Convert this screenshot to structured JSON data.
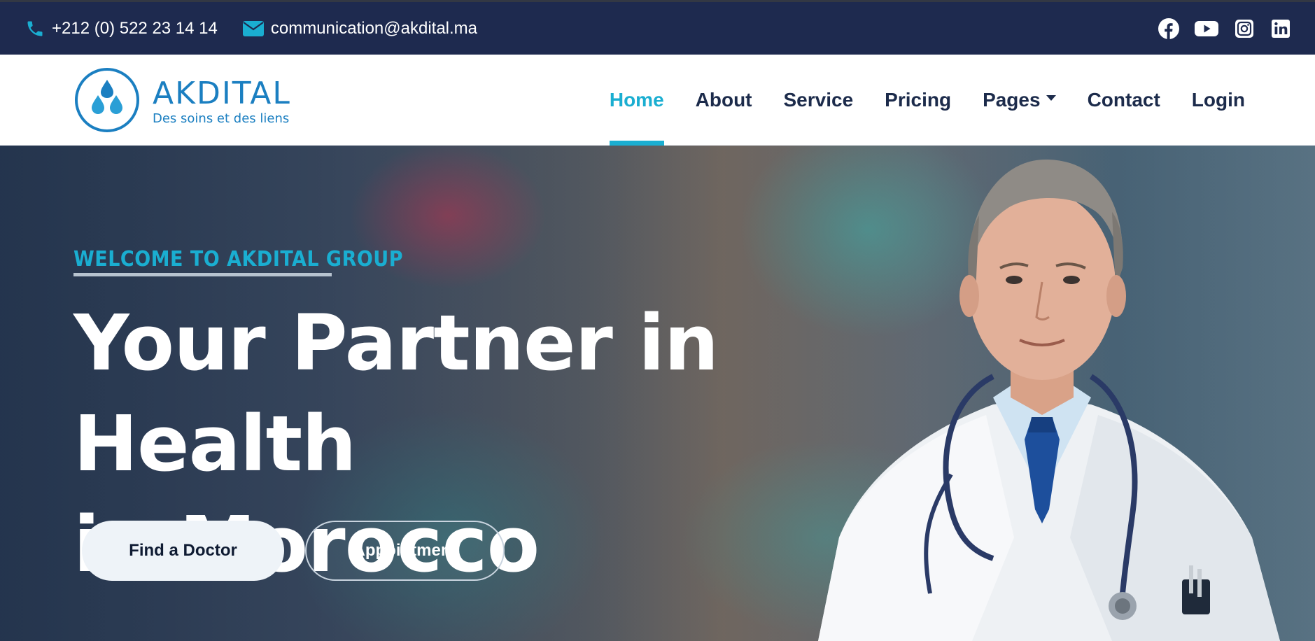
{
  "topbar": {
    "phone": "+212 (0) 522 23 14 14",
    "email": "communication@akdital.ma",
    "phone_icon": "phone-icon",
    "email_icon": "envelope-icon",
    "social": [
      "facebook-icon",
      "youtube-icon",
      "instagram-icon",
      "linkedin-icon"
    ]
  },
  "brand": {
    "name": "AKDITAL",
    "tagline": "Des soins et des liens",
    "color": "#1b7fc1"
  },
  "nav": {
    "items": [
      {
        "label": "Home",
        "active": true
      },
      {
        "label": "About"
      },
      {
        "label": "Service"
      },
      {
        "label": "Pricing"
      },
      {
        "label": "Pages"
      },
      {
        "label": "Contact"
      },
      {
        "label": "Login"
      }
    ],
    "accent": "#1aaed1"
  },
  "hero": {
    "eyebrow": "WELCOME TO AKDITAL GROUP",
    "title_line1": "Your Partner in Health",
    "title_line2": "in Morocco",
    "primary_button": "Find a Doctor",
    "secondary_button": "Appointment"
  },
  "colors": {
    "topbar_bg": "#1e2a4f",
    "nav_text": "#1c2b4b"
  }
}
